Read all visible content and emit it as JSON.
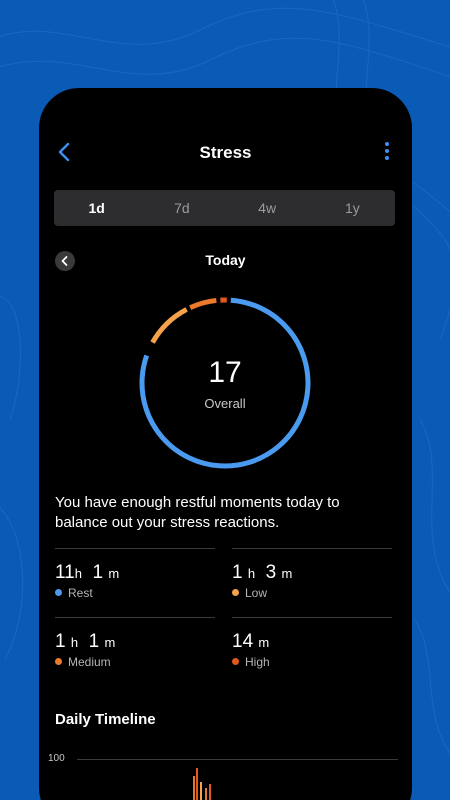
{
  "header": {
    "title": "Stress"
  },
  "tabs": [
    {
      "label": "1d",
      "active": true
    },
    {
      "label": "7d",
      "active": false
    },
    {
      "label": "4w",
      "active": false
    },
    {
      "label": "1y",
      "active": false
    }
  ],
  "date": {
    "label": "Today"
  },
  "summary": {
    "score": "17",
    "score_label": "Overall",
    "message": "You have enough restful moments today to balance out your stress reactions.",
    "ring_fractions": {
      "rest": 0.8,
      "low": 0.1,
      "medium": 0.06,
      "high": 0.02
    }
  },
  "stats": [
    {
      "h": "11",
      "h_unit": "h",
      "m": "1",
      "m_unit": "m",
      "label": "Rest",
      "color": "#4a9bf0"
    },
    {
      "h": "1",
      "h_unit": "h",
      "m": "3",
      "m_unit": "m",
      "label": "Low",
      "color": "#f5a24a"
    },
    {
      "h": "1",
      "h_unit": "h",
      "m": "1",
      "m_unit": "m",
      "label": "Medium",
      "color": "#ec7a2a"
    },
    {
      "h": "",
      "h_unit": "",
      "m": "14",
      "m_unit": "m",
      "label": "High",
      "color": "#e2581f"
    }
  ],
  "timeline": {
    "title": "Daily Timeline",
    "max_label": "100"
  },
  "colors": {
    "accent": "#3d8ff5",
    "rest": "#4a9bf0",
    "low": "#f5a24a",
    "medium": "#ec7a2a",
    "high": "#e2581f",
    "background": "#0a5bb5"
  },
  "icons": {
    "back": "chevron-left-icon",
    "more": "more-vertical-icon",
    "prev": "chevron-left-icon"
  }
}
